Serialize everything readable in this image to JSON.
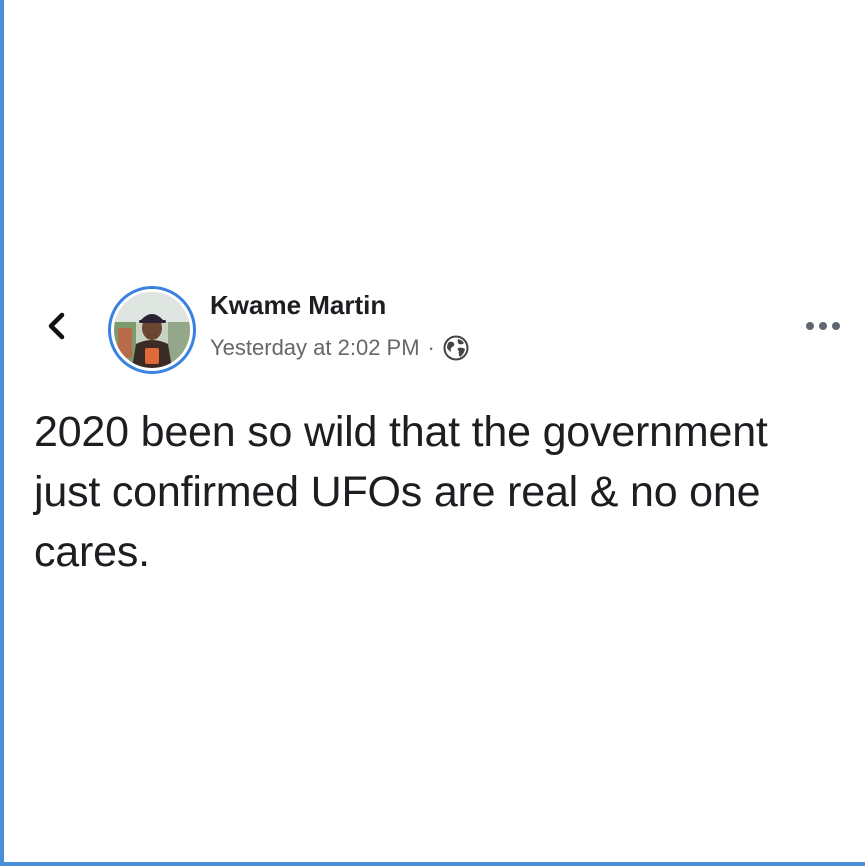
{
  "post": {
    "author_name": "Kwame Martin",
    "timestamp": "Yesterday at 2:02 PM",
    "separator": "·",
    "privacy_icon": "globe-icon",
    "text": "2020 been so wild that the government just confirmed UFOs are real & no one cares."
  },
  "icons": {
    "back": "chevron-left-icon",
    "more": "more-options-icon"
  },
  "colors": {
    "frame_border": "#4a90d9",
    "avatar_ring": "#3b82e0",
    "name_text": "#1c1e21",
    "meta_text": "#65676b"
  }
}
